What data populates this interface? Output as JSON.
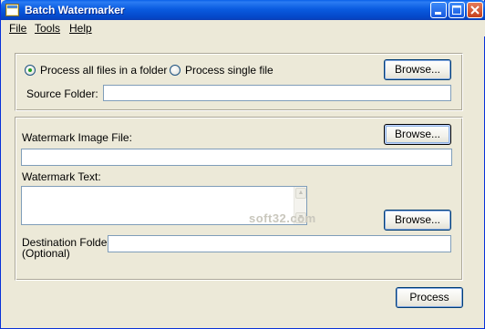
{
  "window": {
    "title": "Batch Watermarker",
    "minimize_icon": "minimize-icon",
    "maximize_icon": "maximize-icon",
    "close_icon": "close-icon"
  },
  "menu": {
    "file": "File",
    "tools": "Tools",
    "help": "Help"
  },
  "source": {
    "radio_all_label": "Process all files in a folder",
    "radio_all_checked": true,
    "radio_single_label": "Process single file",
    "radio_single_checked": false,
    "browse_label": "Browse...",
    "folder_label": "Source Folder:",
    "folder_value": ""
  },
  "watermark": {
    "image_label": "Watermark Image File:",
    "image_browse_label": "Browse...",
    "image_value": "",
    "text_label": "Watermark Text:",
    "text_value": "",
    "dest_browse_label": "Browse...",
    "dest_label_1": "Destination Folder:",
    "dest_label_2": "(Optional)",
    "dest_value": ""
  },
  "actions": {
    "process_label": "Process"
  },
  "overlay": {
    "watermark_text": "soft32.com"
  },
  "colors": {
    "titlebar": "#0a5be0",
    "window_bg": "#ece9d8",
    "field_border": "#7f9db9",
    "radio_dot": "#21a121"
  }
}
